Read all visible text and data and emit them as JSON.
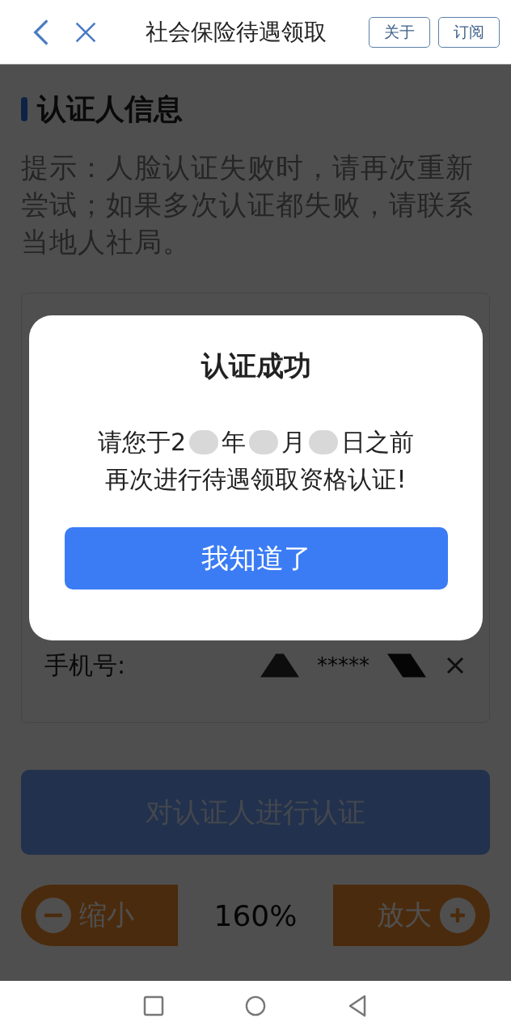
{
  "top_bar": {
    "title": "社会保险待遇领取",
    "buttons": [
      "关于",
      "订阅"
    ]
  },
  "page": {
    "heading": "认证人信息",
    "hint": "提示：人脸认证失败时，请再次重新尝试；如果多次认证都失败，请联系当地人社局。",
    "phone": {
      "label": "手机号:",
      "value": "*****"
    },
    "submit_button": {
      "label": "对认证人进行认证",
      "disabled": true
    },
    "zoom": {
      "out_label": "缩小",
      "value": "160%",
      "in_label": "放大"
    }
  },
  "dialog": {
    "title": "认证成功",
    "message_parts": [
      "请您于2",
      "年",
      "月",
      "日之前"
    ],
    "message_line2": "再次进行待遇领取资格认证!",
    "button": "我知道了"
  }
}
